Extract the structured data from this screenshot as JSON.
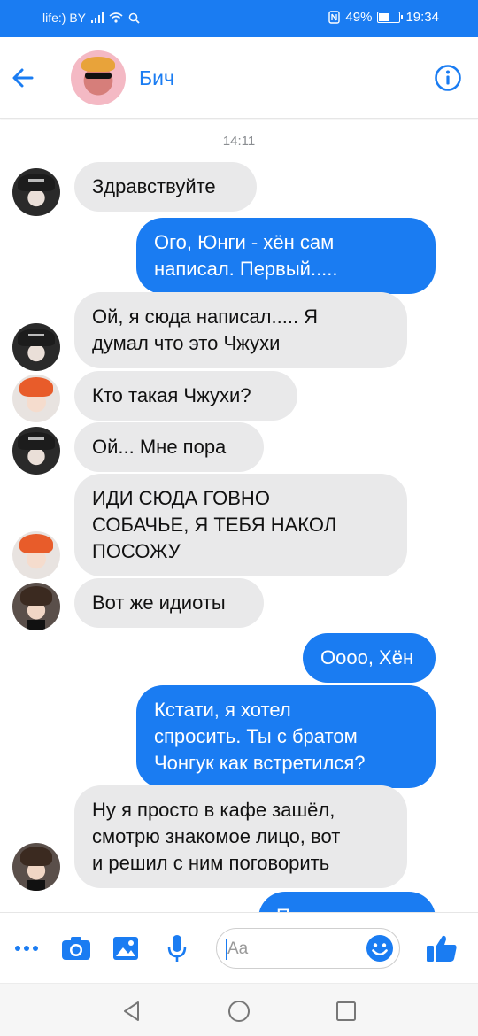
{
  "status_bar": {
    "carrier": "life:) BY",
    "battery": "49%",
    "time": "19:34"
  },
  "header": {
    "contact_name": "Бич"
  },
  "thread": {
    "timestamp": "14:11",
    "messages": [
      {
        "dir": "in",
        "text": "Здравствуйте"
      },
      {
        "dir": "out",
        "text": "Ого, Юнги - хён сам\nнаписал. Первый....."
      },
      {
        "dir": "in",
        "text": "Ой, я сюда написал..... Я\nдумал что это Чжухи"
      },
      {
        "dir": "in",
        "text": "Кто такая Чжухи?"
      },
      {
        "dir": "in",
        "text": "Ой... Мне пора"
      },
      {
        "dir": "in",
        "text": "ИДИ СЮДА ГОВНО\nСОБАЧЬЕ, Я ТЕБЯ НАКОЛ\nПОСОЖУ"
      },
      {
        "dir": "in",
        "text": "Вот же идиоты"
      },
      {
        "dir": "out",
        "text": "Оооо, Хён"
      },
      {
        "dir": "out",
        "text": "Кстати, я хотел\nспросить. Ты с братом\nЧонгук как встретился?"
      },
      {
        "dir": "in",
        "text": "Ну я просто в кафе зашёл,\nсмотрю знакомое лицо, вот\nи решил с ним поговорить"
      },
      {
        "dir": "out",
        "text": "П"
      }
    ]
  },
  "composer": {
    "placeholder": "Aa"
  },
  "colors": {
    "accent": "#1a7cf2",
    "incoming_bubble": "#e9e9ea",
    "outgoing_bubble": "#1a7cf2"
  },
  "icons": [
    "back-arrow-icon",
    "info-icon",
    "more-icon",
    "camera-icon",
    "image-icon",
    "microphone-icon",
    "emoji-icon",
    "like-icon",
    "nav-back-icon",
    "nav-home-icon",
    "nav-recents-icon"
  ]
}
